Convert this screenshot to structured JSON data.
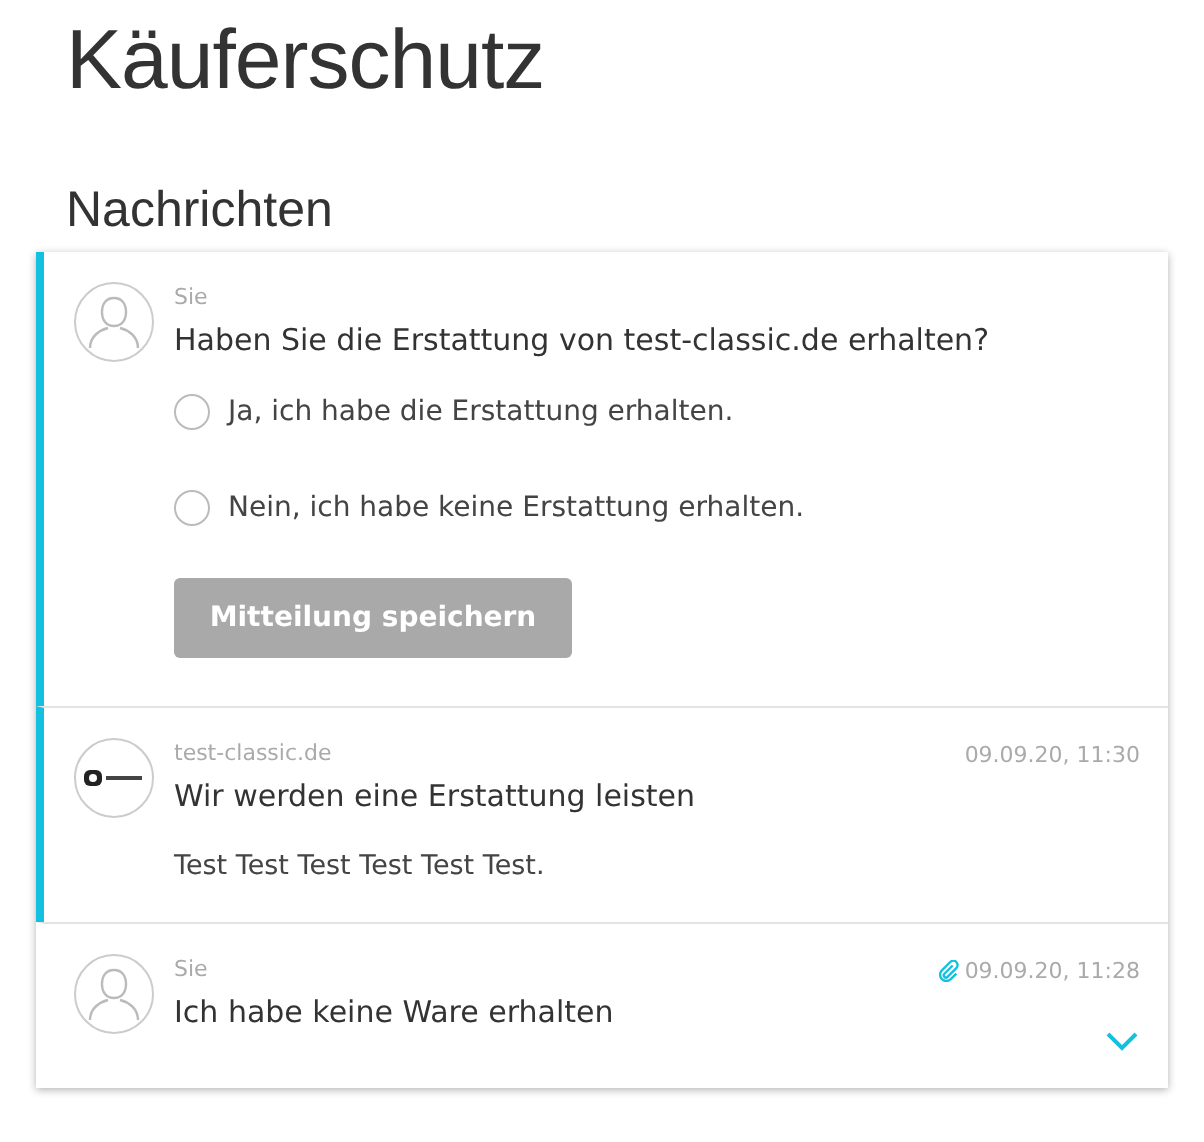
{
  "title": "Käuferschutz",
  "section_title": "Nachrichten",
  "messages": [
    {
      "highlighted": true,
      "kind": "person",
      "sender": "Sie",
      "subject": "Haben Sie die Erstattung von test-classic.de erhalten?",
      "options": [
        {
          "label": "Ja, ich habe die Erstattung erhalten.",
          "selected": false
        },
        {
          "label": "Nein, ich habe keine Erstattung erhalten.",
          "selected": false
        }
      ],
      "button": {
        "label": "Mitteilung speichern",
        "disabled": true
      }
    },
    {
      "highlighted": true,
      "kind": "logo",
      "sender": "test-classic.de",
      "time": "09.09.20, 11:30",
      "subject": "Wir werden eine Erstattung leisten",
      "body": "Test Test Test Test Test Test."
    },
    {
      "highlighted": false,
      "kind": "person",
      "sender": "Sie",
      "time": "09.09.20, 11:28",
      "attachment": true,
      "subject": "Ich habe keine Ware erhalten",
      "expandable": true
    }
  ]
}
